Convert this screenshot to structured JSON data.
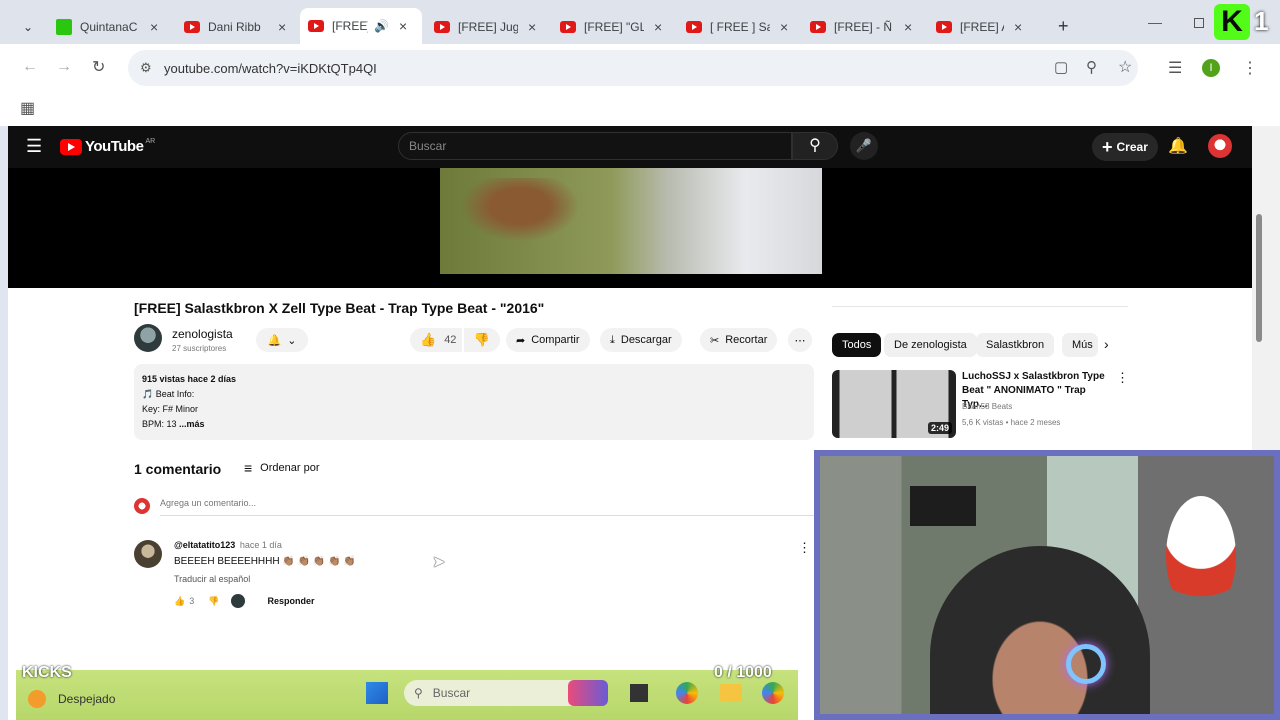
{
  "browser": {
    "tabs": [
      {
        "title": "QuintanaC",
        "icon": "kick-icon"
      },
      {
        "title": "Dani Ribb",
        "icon": "youtube-icon"
      },
      {
        "title": "[FREE]",
        "icon": "youtube-icon",
        "active": true
      },
      {
        "title": "[FREE] Jug",
        "icon": "youtube-icon"
      },
      {
        "title": "[FREE] \"GL",
        "icon": "youtube-icon"
      },
      {
        "title": "[ FREE ] Sa",
        "icon": "youtube-icon"
      },
      {
        "title": "[FREE] - Ñ",
        "icon": "youtube-icon"
      },
      {
        "title": "[FREE] AL",
        "icon": "youtube-icon"
      }
    ],
    "url": "youtube.com/watch?v=iKDKtQTp4QI",
    "profile_initial": "I",
    "kick_badge": "1"
  },
  "youtube": {
    "logo_text": "YouTube",
    "region": "AR",
    "search_placeholder": "Buscar",
    "create_label": "Crear",
    "video": {
      "title": "[FREE] Salastkbron X Zell Type Beat - Trap Type Beat - \"2016\"",
      "channel": "zenologista",
      "subscribers": "27 suscriptores",
      "likes": "42",
      "share_label": "Compartir",
      "download_label": "Descargar",
      "clip_label": "Recortar"
    },
    "description": {
      "stats": "915 vistas  hace 2 días",
      "line1": "🎵 Beat Info:",
      "line2": "Key: F# Minor",
      "line3": "BPM: 13",
      "more": "...más"
    },
    "comments": {
      "count_label": "1 comentario",
      "sort_label": "Ordenar por",
      "add_placeholder": "Agrega un comentario...",
      "items": [
        {
          "author": "@eltatatito123",
          "time": "hace 1 día",
          "text": "BEEEEH BEEEEHHHH 👏🏽 👏🏽 👏🏽 👏🏽 👏🏽",
          "translate": "Traducir al español",
          "likes": "3",
          "reply_label": "Responder"
        }
      ]
    },
    "chips": [
      "Todos",
      "De zenologista",
      "Salastkbron",
      "Mús"
    ],
    "recommended": [
      {
        "title": "LuchoSSJ x Salastkbron Type Beat \" ANONIMATO \" Trap Typ...",
        "channel": "Brian58 Beats",
        "meta": "5,6 K vistas • hace 2 meses",
        "duration": "2:49"
      }
    ]
  },
  "taskbar": {
    "weather": "Despejado",
    "search_placeholder": "Buscar",
    "overlay_left": "KICKS",
    "overlay_right": "0 / 1000"
  },
  "colors": {
    "yt_red": "#ff0000",
    "kick_green": "#53fc18",
    "taskbar_green": "#b7d76a"
  }
}
